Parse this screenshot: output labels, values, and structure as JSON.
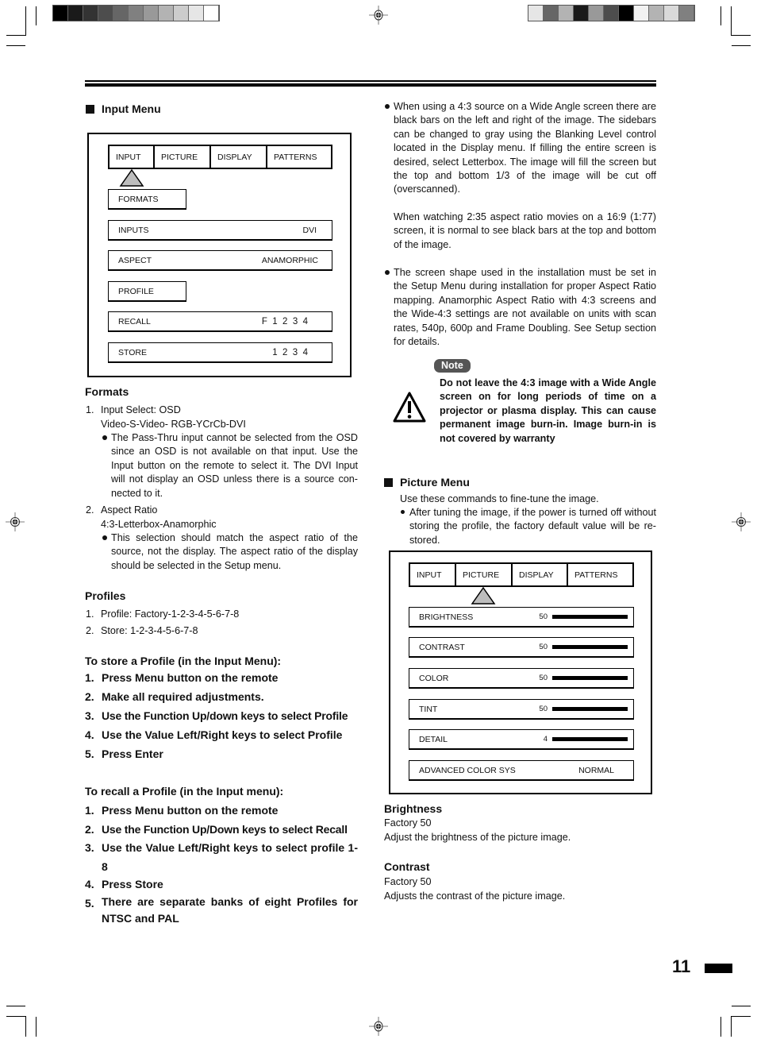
{
  "page_number": "11",
  "print_marks": {
    "left_colorbar": [
      "#000000",
      "#1a1a1a",
      "#333333",
      "#4d4d4d",
      "#666666",
      "#808080",
      "#999999",
      "#b3b3b3",
      "#cccccc",
      "#e6e6e6",
      "#ffffff"
    ],
    "right_colorbar": [
      "#e6e6e6",
      "#666666",
      "#b3b3b3",
      "#1a1a1a",
      "#999999",
      "#4d4d4d",
      "#000000",
      "#f2f2f2",
      "#b3b3b3",
      "#d9d9d9",
      "#808080"
    ]
  },
  "left": {
    "input_menu": {
      "title": "Input Menu",
      "tabs": [
        "INPUT",
        "PICTURE",
        "DISPLAY",
        "PATTERNS"
      ],
      "active_tab": "INPUT",
      "rows": [
        {
          "label": "FORMATS",
          "value": ""
        },
        {
          "label": "INPUTS",
          "value": "DVI"
        },
        {
          "label": "ASPECT",
          "value": "ANAMORPHIC"
        },
        {
          "label": "PROFILE",
          "value": ""
        },
        {
          "label": "RECALL",
          "value": "F  1  2  3  4"
        },
        {
          "label": "STORE",
          "value": "1  2  3  4"
        }
      ]
    },
    "formats": {
      "heading": "Formats",
      "items": [
        {
          "num": "1.",
          "line1": "Input Select: OSD",
          "line2": "Video-S-Video- RGB-YCrCb-DVI",
          "bullet": "The Pass-Thru input cannot be selected from the OSD since an OSD is not available on that input. Use the Input button on the remote to select it. The DVI Input will not display an OSD unless there is a source con-nected to it."
        },
        {
          "num": "2.",
          "line1": "Aspect Ratio",
          "line2": "4:3-Letterbox-Anamorphic",
          "bullet": "This selection should match the aspect ratio of the source, not the display. The aspect ratio of the display should be selected in the Setup menu."
        }
      ]
    },
    "profiles": {
      "heading": "Profiles",
      "items": [
        {
          "num": "1.",
          "text": "Profile: Factory-1-2-3-4-5-6-7-8"
        },
        {
          "num": "2.",
          "text": "Store: 1-2-3-4-5-6-7-8"
        }
      ]
    },
    "store_profile": {
      "heading": "To store a Profile (in the Input Menu):",
      "steps": [
        {
          "num": "1.",
          "text": "Press Menu button on the remote"
        },
        {
          "num": "2.",
          "text": "Make all required adjustments."
        },
        {
          "num": "3.",
          "text": "Use the Function Up/down keys to select Profile"
        },
        {
          "num": "4.",
          "text": "Use the Value Left/Right keys to select Profile"
        },
        {
          "num": "5.",
          "text": "Press Enter"
        }
      ]
    },
    "recall_profile": {
      "heading": "To recall a Profile (in the Input menu):",
      "steps": [
        {
          "num": "1.",
          "text": "Press Menu button on the remote"
        },
        {
          "num": "2.",
          "text": "Use the Function Up/Down keys to select Recall"
        },
        {
          "num": "3.",
          "text": "Use the Value Left/Right keys to select profile 1-8"
        },
        {
          "num": "4.",
          "text": "Press Store"
        },
        {
          "num": "5.",
          "text": "There are separate banks of eight Profiles for NTSC and PAL"
        }
      ]
    }
  },
  "right": {
    "bullet1": "When using a 4:3 source on a Wide Angle screen there are black bars on the left and right of the image. The sidebars can be changed to gray using the Blanking Level control located in the Display menu. If filling the entire screen is desired, select Letterbox. The image will fill the screen but the top and bottom 1/3 of the image will be cut off (overscanned).",
    "bullet1_para2": "When watching 2:35 aspect ratio movies on a 16:9 (1:77) screen, it is normal to see black bars at the top and bottom of the image.",
    "bullet2": "The screen shape used in the installation must be set in the Setup Menu during installation for proper Aspect Ratio mapping. Anamorphic Aspect Ratio with 4:3 screens and the Wide-4:3 settings are not available on units with scan rates, 540p, 600p and Frame Doubling. See Setup section for details.",
    "note": {
      "badge": "Note",
      "icon": "warning-triangle-icon",
      "text": "Do not leave the 4:3 image with a Wide Angle screen on for long periods of time on a projector or plasma display. This can cause permanent image burn-in. Image burn-in is not covered by warranty"
    },
    "picture_menu": {
      "title": "Picture Menu",
      "intro": "Use these commands to fine-tune the image.",
      "bullet": "After tuning the image, if the power is turned off without storing the profile, the factory default value will be re-stored.",
      "tabs": [
        "INPUT",
        "PICTURE",
        "DISPLAY",
        "PATTERNS"
      ],
      "active_tab": "PICTURE",
      "rows": [
        {
          "label": "BRIGHTNESS",
          "value": "50",
          "bar": true
        },
        {
          "label": "CONTRAST",
          "value": "50",
          "bar": true
        },
        {
          "label": "COLOR",
          "value": "50",
          "bar": true
        },
        {
          "label": "TINT",
          "value": "50",
          "bar": true
        },
        {
          "label": "DETAIL",
          "value": "4",
          "bar": true
        },
        {
          "label": "ADVANCED COLOR SYS",
          "value": "NORMAL",
          "bar": false
        }
      ]
    },
    "brightness": {
      "heading": "Brightness",
      "factory": "Factory 50",
      "desc": "Adjust the brightness of the picture image."
    },
    "contrast": {
      "heading": "Contrast",
      "factory": "Factory 50",
      "desc": "Adjusts the contrast of the picture image."
    }
  }
}
